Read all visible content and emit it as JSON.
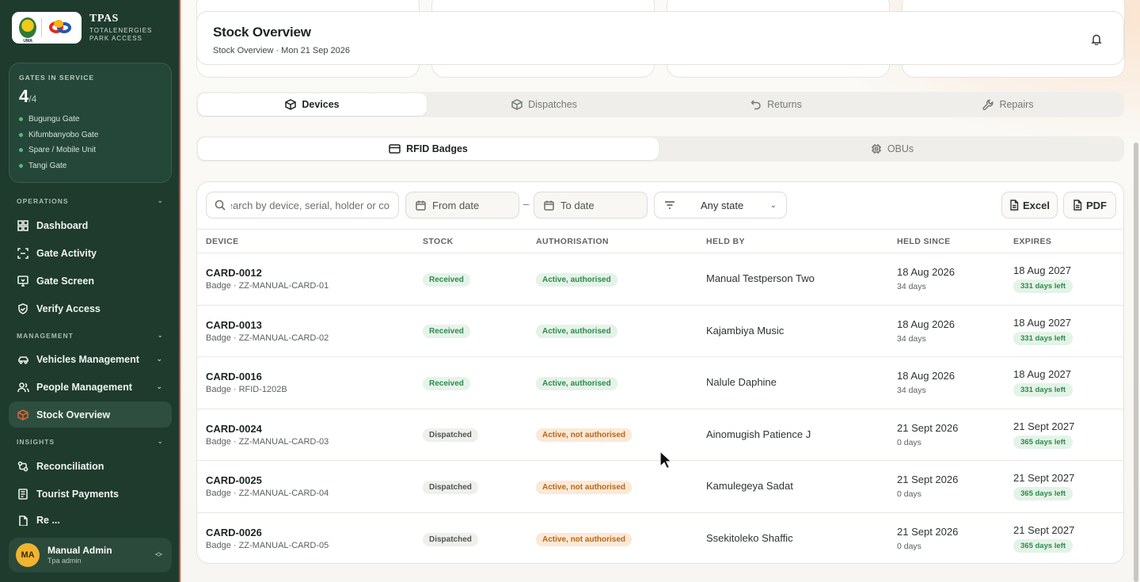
{
  "brand": {
    "title": "TPAS",
    "subtitle_line1": "TOTALENERGIES",
    "subtitle_line2": "PARK ACCESS",
    "uwa_label": "UWA"
  },
  "gates": {
    "label": "GATES IN SERVICE",
    "count": "4",
    "total": "/4",
    "list": [
      "Bugungu Gate",
      "Kifumbanyobo Gate",
      "Spare / Mobile Unit",
      "Tangi Gate"
    ]
  },
  "nav": {
    "operations_label": "OPERATIONS",
    "dashboard": "Dashboard",
    "gate_activity": "Gate Activity",
    "gate_screen": "Gate Screen",
    "verify_access": "Verify Access",
    "management_label": "MANAGEMENT",
    "vehicles": "Vehicles Management",
    "people": "People Management",
    "stock": "Stock Overview",
    "insights_label": "INSIGHTS",
    "reconciliation": "Reconciliation",
    "tourist_payments": "Tourist Payments",
    "reports_partial": "Re  ..."
  },
  "user": {
    "initials": "MA",
    "name": "Manual Admin",
    "role": "Tpa admin"
  },
  "header": {
    "title": "Stock Overview",
    "subtitle": "Stock Overview · Mon 21 Sep 2026"
  },
  "tabs": [
    "Devices",
    "Dispatches",
    "Returns",
    "Repairs"
  ],
  "subtabs": [
    "RFID Badges",
    "OBUs"
  ],
  "toolbar": {
    "search_placeholder": "Search by device, serial, holder or co",
    "from_date": "From date",
    "to_date": "To date",
    "dash": "–",
    "state": "Any state",
    "excel": "Excel",
    "pdf": "PDF"
  },
  "columns": [
    "DEVICE",
    "STOCK",
    "AUTHORISATION",
    "HELD BY",
    "HELD SINCE",
    "EXPIRES"
  ],
  "rows": [
    {
      "id": "CARD-0012",
      "sub": "Badge · ZZ-MANUAL-CARD-01",
      "stock": "Received",
      "auth": "Active, authorised",
      "holder": "Manual Testperson Two",
      "since": "18 Aug 2026",
      "since_days": "34 days",
      "expires": "18 Aug 2027",
      "left": "331 days left"
    },
    {
      "id": "CARD-0013",
      "sub": "Badge · ZZ-MANUAL-CARD-02",
      "stock": "Received",
      "auth": "Active, authorised",
      "holder": "Kajambiya Music",
      "since": "18 Aug 2026",
      "since_days": "34 days",
      "expires": "18 Aug 2027",
      "left": "331 days left"
    },
    {
      "id": "CARD-0016",
      "sub": "Badge · RFID-1202B",
      "stock": "Received",
      "auth": "Active, authorised",
      "holder": "Nalule Daphine",
      "since": "18 Aug 2026",
      "since_days": "34 days",
      "expires": "18 Aug 2027",
      "left": "331 days left"
    },
    {
      "id": "CARD-0024",
      "sub": "Badge · ZZ-MANUAL-CARD-03",
      "stock": "Dispatched",
      "auth": "Active, not authorised",
      "holder": "Ainomugish Patience J",
      "since": "21 Sept 2026",
      "since_days": "0 days",
      "expires": "21 Sept 2027",
      "left": "365 days left"
    },
    {
      "id": "CARD-0025",
      "sub": "Badge · ZZ-MANUAL-CARD-04",
      "stock": "Dispatched",
      "auth": "Active, not authorised",
      "holder": "Kamulegeya Sadat",
      "since": "21 Sept 2026",
      "since_days": "0 days",
      "expires": "21 Sept 2027",
      "left": "365 days left"
    },
    {
      "id": "CARD-0026",
      "sub": "Badge · ZZ-MANUAL-CARD-05",
      "stock": "Dispatched",
      "auth": "Active, not authorised",
      "holder": "Ssekitoleko Shaffic",
      "since": "21 Sept 2026",
      "since_days": "0 days",
      "expires": "21 Sept 2027",
      "left": "365 days left"
    }
  ],
  "colors": {
    "sidebar": "#1e3b2d",
    "accent_green": "#2f8a4b",
    "warning_orange": "#b9661b",
    "avatar": "#f0b42f"
  }
}
